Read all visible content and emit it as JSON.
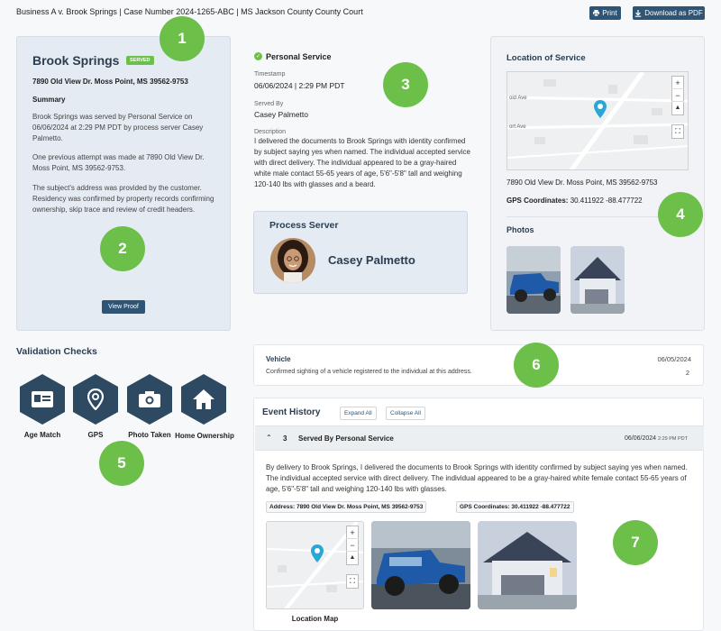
{
  "header": {
    "title": "Business A v. Brook Springs | Case Number 2024-1265-ABC | MS Jackson County County Court",
    "print_label": "Print",
    "download_label": "Download as PDF"
  },
  "callouts": [
    "1",
    "2",
    "3",
    "4",
    "5",
    "6",
    "7"
  ],
  "subject": {
    "name": "Brook Springs",
    "status_badge": "SERVED",
    "address": "7890 Old View Dr. Moss Point, MS 39562-9753",
    "summary_heading": "Summary",
    "summary_p1": "Brook Springs was served by Personal Service on 06/06/2024 at 2:29 PM PDT by process server Casey Palmetto.",
    "summary_p2": "One previous attempt was made at 7890 Old View Dr. Moss Point, MS 39562-9753.",
    "summary_p3": "The subject's address was provided by the customer. Residency was confirmed by property records confirming ownership, skip trace and review of credit headers.",
    "view_proof_label": "View Proof"
  },
  "service": {
    "type": "Personal Service",
    "timestamp_label": "Timestamp",
    "timestamp": "06/06/2024 | 2:29 PM PDT",
    "served_by_label": "Served By",
    "served_by": "Casey Palmetto",
    "description_label": "Description",
    "description": "I delivered the documents to Brook Springs with identity confirmed by subject saying yes when named. The individual accepted service with direct delivery. The individual appeared to be a gray-haired white male contact 55-65 years of age, 5'6\"-5'8\" tall and weighing 120-140 lbs with glasses and a beard."
  },
  "process_server": {
    "heading": "Process Server",
    "name": "Casey Palmetto"
  },
  "location": {
    "heading": "Location of Service",
    "map_street_1": "oid Ave",
    "map_street_2": "ort Ave",
    "address": "7890 Old View Dr. Moss Point, MS 39562-9753",
    "gps_label": "GPS Coordinates:",
    "gps_value": "30.411922 -88.477722",
    "photos_heading": "Photos"
  },
  "validation": {
    "heading": "Validation Checks",
    "items": [
      {
        "label": "Age Match",
        "icon": "id-card-icon"
      },
      {
        "label": "GPS",
        "icon": "map-pin-icon"
      },
      {
        "label": "Photo Taken",
        "icon": "camera-icon"
      },
      {
        "label": "Home Ownership",
        "icon": "house-icon"
      }
    ]
  },
  "vehicle": {
    "title": "Vehicle",
    "description": "Confirmed sighting of a vehicle registered to the individual at this address.",
    "date": "06/05/2024",
    "count": "2"
  },
  "event_history": {
    "heading": "Event History",
    "expand_all": "Expand All",
    "collapse_all": "Collapse All",
    "event": {
      "number": "3",
      "title": "Served By Personal Service",
      "date": "06/06/2024",
      "time": "2:29 PM PDT",
      "text": "By delivery to Brook Springs, I delivered the documents to Brook Springs with identity confirmed by subject saying yes when named. The individual accepted service with direct delivery. The individual appeared to be a gray-haired white female contact 55-65 years of age, 5'6\"-5'8\" tall and weighing 120-140 lbs with glasses.",
      "address_tag": "Address: 7890 Old View Dr. Moss Point, MS 39562-9753",
      "gps_tag": "GPS Coordinates: 30.411922 -88.477722",
      "map_caption": "Location Map"
    }
  },
  "colors": {
    "accent": "#2f5576",
    "badge_green": "#6cc04a",
    "panel_blue": "#e4ebf2",
    "hex_navy": "#2e4a62"
  }
}
